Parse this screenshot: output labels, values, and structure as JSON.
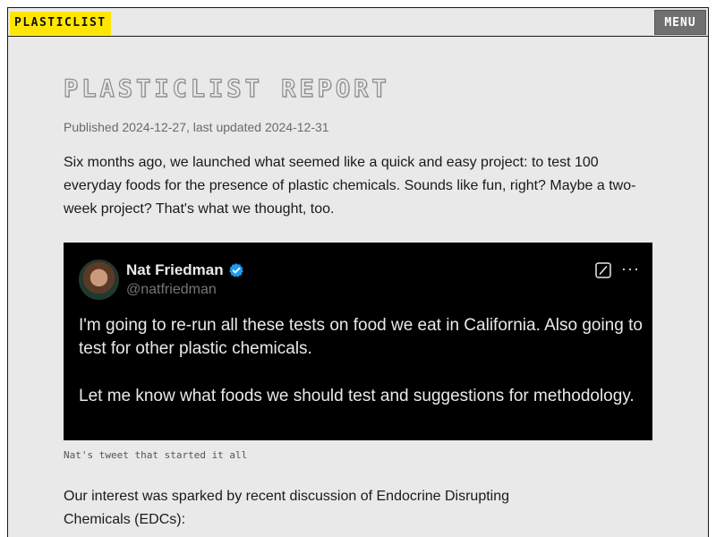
{
  "header": {
    "logo": "PLASTICLIST",
    "menu_label": "MENU"
  },
  "article": {
    "title": "PLASTICLIST REPORT",
    "published": "Published 2024-12-27, last updated 2024-12-31",
    "intro": "Six months ago, we launched what seemed like a quick and easy project: to test 100 everyday foods for the presence of plastic chemicals. Sounds like fun, right? Maybe a two-week project? That's what we thought, too.",
    "caption": "Nat's tweet that started it all",
    "para2": "Our interest was sparked by recent discussion of Endocrine Disrupting Chemicals (EDCs):"
  },
  "tweet": {
    "author": "Nat Friedman",
    "handle": "@natfriedman",
    "line1": "I'm going to re-run all these tests on food we eat in California. Also going to test for other plastic chemicals.",
    "line2": "Let me know what foods we should test and suggestions for methodology.",
    "icons": {
      "verified": "verified-badge-icon",
      "grok": "grok-icon",
      "more": "more-options-icon"
    }
  },
  "colors": {
    "logo_bg": "#ffe600",
    "menu_bg": "#707070",
    "page_bg": "#e9e9e9",
    "tweet_bg": "#000000",
    "verified": "#1d9bf0"
  }
}
